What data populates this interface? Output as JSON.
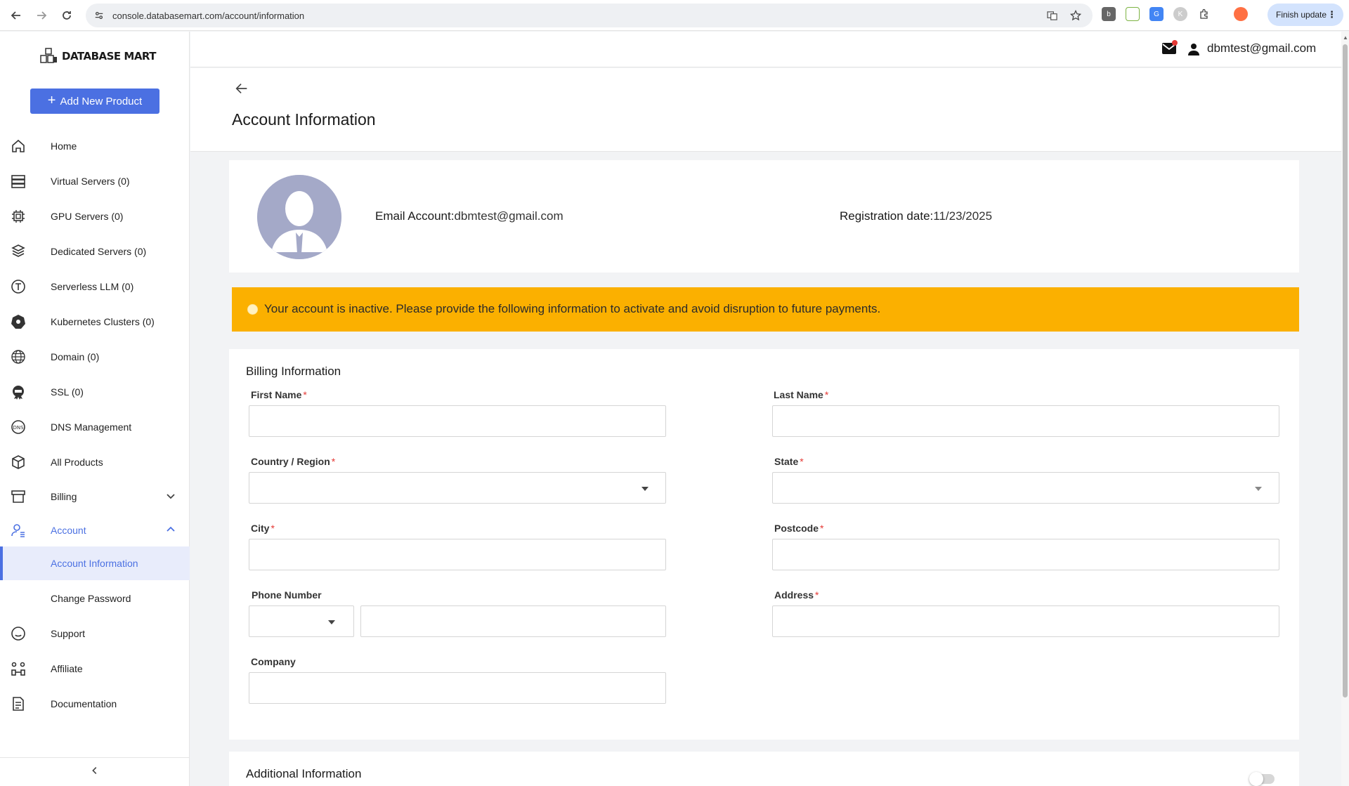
{
  "browser": {
    "url": "console.databasemart.com/account/information",
    "finish_update_label": "Finish update"
  },
  "brand": {
    "name": "DATABASE MART"
  },
  "sidebar": {
    "add_button_label": "Add New Product",
    "items": [
      {
        "label": "Home",
        "icon": "home-icon"
      },
      {
        "label": "Virtual Servers (0)",
        "icon": "server-stack-icon"
      },
      {
        "label": "GPU Servers (0)",
        "icon": "chip-icon"
      },
      {
        "label": "Dedicated Servers (0)",
        "icon": "cube-stack-icon"
      },
      {
        "label": "Serverless LLM (0)",
        "icon": "llm-icon"
      },
      {
        "label": "Kubernetes Clusters (0)",
        "icon": "kubernetes-icon"
      },
      {
        "label": "Domain (0)",
        "icon": "globe-icon"
      },
      {
        "label": "SSL (0)",
        "icon": "ssl-icon"
      },
      {
        "label": "DNS Management",
        "icon": "dns-icon"
      },
      {
        "label": "All Products",
        "icon": "box-icon"
      },
      {
        "label": "Billing",
        "icon": "billing-icon"
      },
      {
        "label": "Account",
        "icon": "account-icon"
      },
      {
        "label": "Account Information",
        "icon": ""
      },
      {
        "label": "Change Password",
        "icon": ""
      },
      {
        "label": "Support",
        "icon": "support-icon"
      },
      {
        "label": "Affiliate",
        "icon": "affiliate-icon"
      },
      {
        "label": "Documentation",
        "icon": "document-icon"
      }
    ]
  },
  "header": {
    "user_email": "dbmtest@gmail.com"
  },
  "page": {
    "title": "Account Information"
  },
  "profile": {
    "email_label": "Email Account:",
    "email_value": "dbmtest@gmail.com",
    "reg_label": "Registration date:",
    "reg_value": "11/23/2025"
  },
  "alert": {
    "text": "Your account is inactive. Please provide the following information to activate and avoid disruption to future payments."
  },
  "billing": {
    "title": "Billing Information",
    "first_name": {
      "label": "First Name",
      "value": ""
    },
    "last_name": {
      "label": "Last Name",
      "value": ""
    },
    "country": {
      "label": "Country / Region",
      "value": ""
    },
    "state": {
      "label": "State",
      "value": ""
    },
    "city": {
      "label": "City",
      "value": ""
    },
    "postcode": {
      "label": "Postcode",
      "value": ""
    },
    "phone": {
      "label": "Phone Number",
      "code": "",
      "value": ""
    },
    "address": {
      "label": "Address",
      "value": ""
    },
    "company": {
      "label": "Company",
      "value": ""
    },
    "required_mark": "*"
  },
  "additional": {
    "title": "Additional Information",
    "enabled": false
  },
  "colors": {
    "accent": "#4b70e2",
    "alert": "#fbb000",
    "required": "#e53935",
    "avatar": "#a4a9c8"
  }
}
